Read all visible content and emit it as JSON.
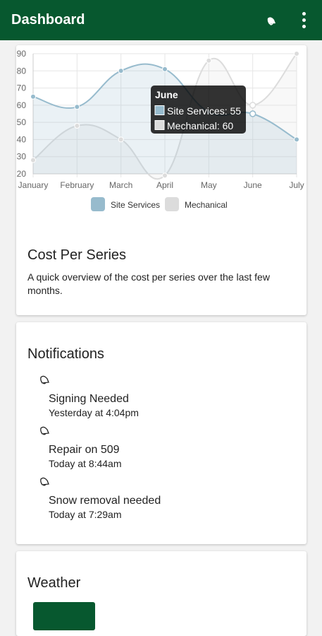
{
  "appbar": {
    "title": "Dashboard",
    "icons": [
      "bell-icon",
      "more-vert-icon"
    ]
  },
  "chart_data": {
    "type": "line",
    "categories": [
      "January",
      "February",
      "March",
      "April",
      "May",
      "June",
      "July"
    ],
    "series": [
      {
        "name": "Site Services",
        "values": [
          65,
          59,
          80,
          81,
          56,
          55,
          40
        ],
        "color": "#97bbcd",
        "fill": "rgba(151,187,205,0.2)"
      },
      {
        "name": "Mechanical",
        "values": [
          28,
          48,
          40,
          19,
          86,
          60,
          90
        ],
        "color": "#dcdcdc",
        "fill": "rgba(220,220,220,0.2)"
      }
    ],
    "yticks": [
      20,
      30,
      40,
      50,
      60,
      70,
      80,
      90
    ],
    "ylim": [
      20,
      90
    ],
    "grid": true,
    "legend": "bottom",
    "tooltip": {
      "title": "June",
      "lines": [
        "Site Services: 55",
        "Mechanical: 60"
      ]
    }
  },
  "cost_card": {
    "title": "Cost Per Series",
    "description": "A quick overview of the cost per series over the last few months."
  },
  "notifications": {
    "title": "Notifications",
    "items": [
      {
        "title": "Signing Needed",
        "time": "Yesterday at 4:04pm",
        "icon": "bell-icon"
      },
      {
        "title": "Repair on 509",
        "time": "Today at 8:44am",
        "icon": "bell-icon"
      },
      {
        "title": "Snow removal needed",
        "time": "Today at 7:29am",
        "icon": "bell-icon"
      }
    ]
  },
  "weather": {
    "title": "Weather"
  }
}
